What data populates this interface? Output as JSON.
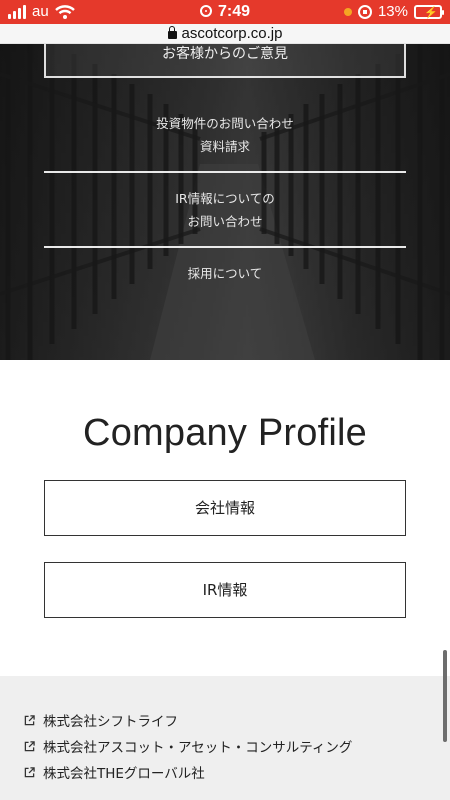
{
  "status_bar": {
    "carrier": "au",
    "time": "7:49",
    "battery": "13%"
  },
  "url_bar": {
    "domain": "ascotcorp.co.jp"
  },
  "hero": {
    "top_box_label": "お客様からのご意見",
    "items": [
      {
        "line1": "投資物件のお問い合わせ",
        "line2": "資料請求"
      },
      {
        "line1": "IR情報についての",
        "line2": "お問い合わせ"
      },
      {
        "line1": "採用について"
      }
    ]
  },
  "company_profile": {
    "title": "Company Profile",
    "buttons": [
      "会社情報",
      "IR情報"
    ]
  },
  "footer": {
    "links": [
      "株式会社シフトライフ",
      "株式会社アスコット・アセット・コンサルティング",
      "株式会社THEグローバル社"
    ]
  }
}
